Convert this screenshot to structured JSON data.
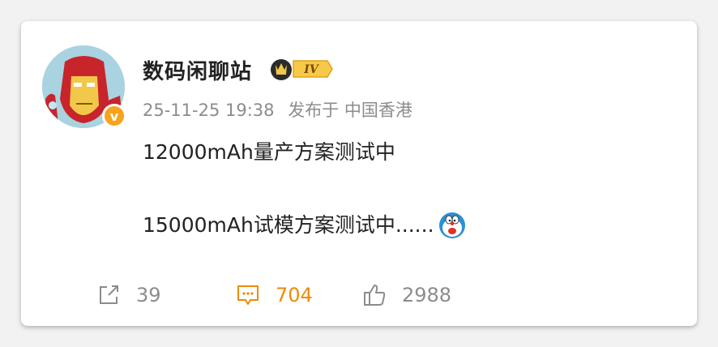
{
  "post": {
    "author": "数码闲聊站",
    "level_badge": "IV",
    "timestamp": "25-11-25 19:38",
    "source": "发布于 中国香港",
    "lines": [
      "12000mAh量产方案测试中",
      "15000mAh试模方案测试中......"
    ],
    "emoji_icon": "doraemon-emoji-icon"
  },
  "actions": {
    "share_count": "39",
    "comment_count": "704",
    "like_count": "2988"
  },
  "colors": {
    "accent": "#f08a00",
    "verified": "#f7a31c",
    "muted": "#8c8c8c",
    "text": "#222222"
  }
}
